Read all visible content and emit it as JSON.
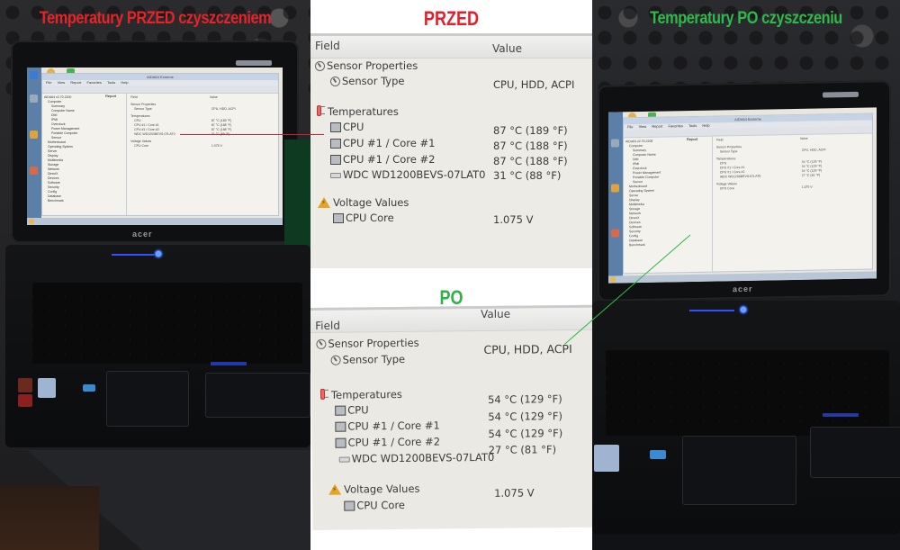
{
  "left_photo": {
    "title": "Temperatury PRZED czyszczeniem",
    "title_color": "#e5242a",
    "laptop_brand": "acer",
    "window_title": "AIDA64 Extreme",
    "menu": [
      "File",
      "View",
      "Report",
      "Favorites",
      "Tools",
      "Help"
    ],
    "toolbar_label": "Report",
    "tree_items": [
      "AIDA64 v2.70.2200",
      "Computer",
      "Summary",
      "Computer Name",
      "DMI",
      "IPMI",
      "Overclock",
      "Power Management",
      "Portable Computer",
      "Sensor",
      "Motherboard",
      "Operating System",
      "Server",
      "Display",
      "Multimedia",
      "Storage",
      "Network",
      "DirectX",
      "Devices",
      "Software",
      "Security",
      "Config",
      "Database",
      "Benchmark"
    ]
  },
  "right_photo": {
    "title": "Temperatury PO czyszczeniu",
    "title_color": "#31b84a",
    "laptop_brand": "acer",
    "window_title": "AIDA64 Extreme",
    "menu": [
      "File",
      "View",
      "Report",
      "Favorites",
      "Tools",
      "Help"
    ],
    "toolbar_label": "Report",
    "tree_items": [
      "AIDA64 v2.70.2200",
      "Computer",
      "Summary",
      "Computer Name",
      "DMI",
      "IPMI",
      "Overclock",
      "Power Management",
      "Portable Computer",
      "Sensor",
      "Motherboard",
      "Operating System",
      "Server",
      "Display",
      "Multimedia",
      "Storage",
      "Network",
      "DirectX",
      "Devices",
      "Software",
      "Security",
      "Config",
      "Database",
      "Benchmark"
    ]
  },
  "before": {
    "heading": "PRZED",
    "heading_color": "#e3202a",
    "columns": {
      "field": "Field",
      "value": "Value"
    },
    "sensor_properties": {
      "group": "Sensor Properties",
      "rows": [
        {
          "field": "Sensor Type",
          "value": "CPU, HDD, ACPI"
        }
      ]
    },
    "temperatures": {
      "group": "Temperatures",
      "rows": [
        {
          "field": "CPU",
          "value": "87 °C  (189 °F)",
          "icon": "chip"
        },
        {
          "field": "CPU #1 / Core #1",
          "value": "87 °C  (188 °F)",
          "icon": "chip"
        },
        {
          "field": "CPU #1 / Core #2",
          "value": "87 °C  (188 °F)",
          "icon": "chip"
        },
        {
          "field": "WDC WD1200BEVS-07LAT0",
          "value": "31 °C  (88 °F)",
          "icon": "hdd"
        }
      ]
    },
    "voltage_values": {
      "group": "Voltage Values",
      "rows": [
        {
          "field": "CPU Core",
          "value": "1.075 V"
        }
      ]
    }
  },
  "after": {
    "heading": "PO",
    "heading_color": "#2bb445",
    "columns": {
      "field": "Field",
      "value": "Value"
    },
    "sensor_properties": {
      "group": "Sensor Properties",
      "rows": [
        {
          "field": "Sensor Type",
          "value": "CPU, HDD, ACPI"
        }
      ]
    },
    "temperatures": {
      "group": "Temperatures",
      "rows": [
        {
          "field": "CPU",
          "value": "54 °C  (129 °F)",
          "icon": "chip"
        },
        {
          "field": "CPU #1 / Core #1",
          "value": "54 °C  (129 °F)",
          "icon": "chip"
        },
        {
          "field": "CPU #1 / Core #2",
          "value": "54 °C  (129 °F)",
          "icon": "chip"
        },
        {
          "field": "WDC WD1200BEVS-07LAT0",
          "value": "27 °C  (81 °F)",
          "icon": "hdd"
        }
      ]
    },
    "voltage_values": {
      "group": "Voltage Values",
      "rows": [
        {
          "field": "CPU Core",
          "value": "1.075 V"
        }
      ]
    }
  }
}
